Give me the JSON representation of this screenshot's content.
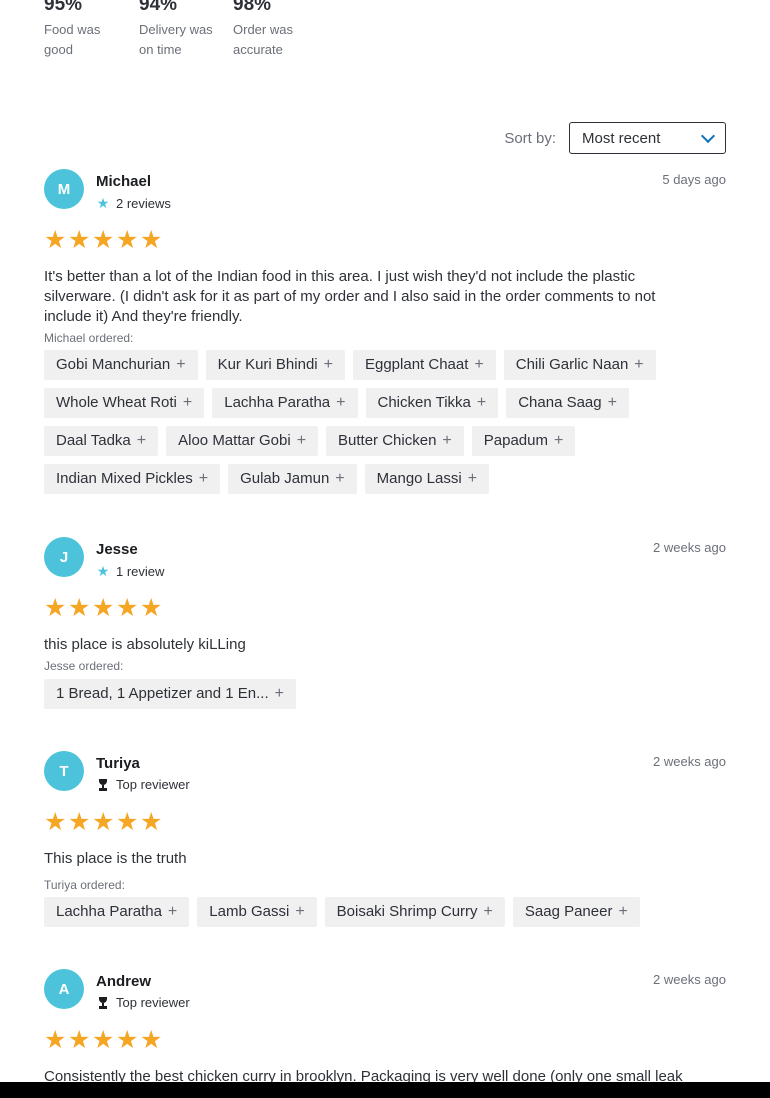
{
  "ratings": [
    {
      "pct": "95%",
      "label": "Food was good"
    },
    {
      "pct": "94%",
      "label": "Delivery was on time"
    },
    {
      "pct": "98%",
      "label": "Order was accurate"
    }
  ],
  "sort": {
    "label": "Sort by:",
    "value": "Most recent"
  },
  "reviews": [
    {
      "initial": "M",
      "name": "Michael",
      "meta": "2 reviews",
      "meta_icon": "star-icon",
      "date": "5 days ago",
      "stars": 5,
      "text": "It's better than a lot of the Indian food in this area. I just wish they'd not include the plastic silverware. (I didn't ask for it as part of my order and I also said in the order comments to not include it) And they're friendly.",
      "ordered_label": "Michael ordered:",
      "items": [
        "Gobi Manchurian",
        "Kur Kuri Bhindi",
        "Eggplant Chaat",
        "Chili Garlic Naan",
        "Whole Wheat Roti",
        "Lachha Paratha",
        "Chicken Tikka",
        "Chana Saag",
        "Daal Tadka",
        "Aloo Mattar Gobi",
        "Butter Chicken",
        "Papadum",
        "Indian Mixed Pickles",
        "Gulab Jamun",
        "Mango Lassi"
      ]
    },
    {
      "initial": "J",
      "name": "Jesse",
      "meta": "1 review",
      "meta_icon": "star-icon",
      "date": "2 weeks ago",
      "stars": 5,
      "text": "this place is absolutely kiLLing",
      "ordered_label": "Jesse ordered:",
      "items": [
        "1 Bread, 1 Appetizer and 1 En..."
      ]
    },
    {
      "initial": "T",
      "name": "Turiya",
      "meta": "Top reviewer",
      "meta_icon": "trophy-icon",
      "date": "2 weeks ago",
      "stars": 5,
      "text": "This place is the truth",
      "ordered_label": "Turiya ordered:",
      "items": [
        "Lachha Paratha",
        "Lamb Gassi",
        "Boisaki Shrimp Curry",
        "Saag Paneer"
      ]
    },
    {
      "initial": "A",
      "name": "Andrew",
      "meta": "Top reviewer",
      "meta_icon": "trophy-icon",
      "date": "2 weeks ago",
      "stars": 5,
      "text": "Consistently the best chicken curry in brooklyn. Packaging is very well done (only one small leak",
      "ordered_label": "",
      "items": []
    }
  ],
  "colors": {
    "accent": "#4cc3db",
    "star": "#f5a623",
    "chip_bg": "#f0f0f1",
    "chevron": "#0f72b8"
  }
}
